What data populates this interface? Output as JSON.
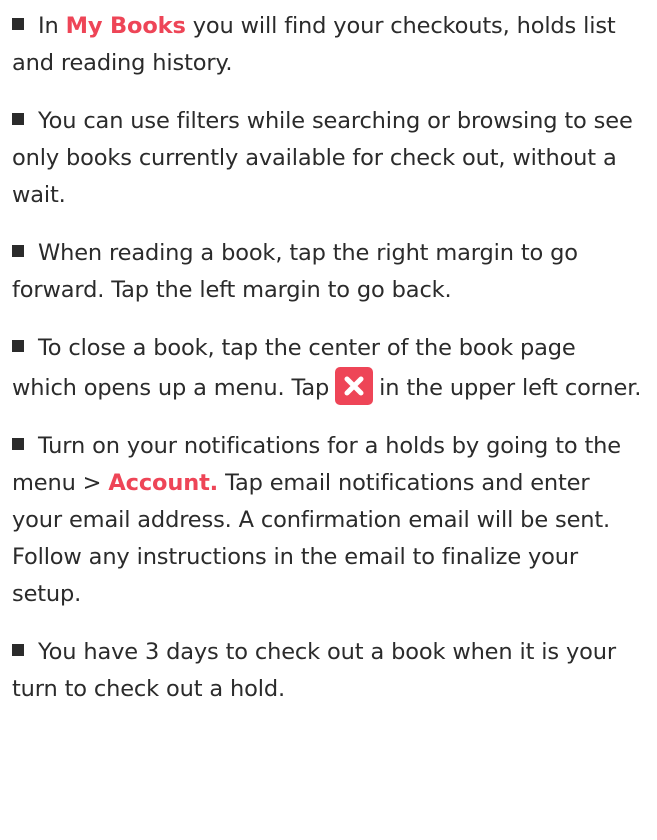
{
  "tips": [
    {
      "before": " In ",
      "highlight": "My Books",
      "after": " you will find your checkouts, holds list and reading history."
    },
    {
      "text": " You can use filters while searching or browsing to see only books currently available for check out, without a wait."
    },
    {
      "text": " When reading a book, tap the right margin to go forward. Tap the left margin to go back."
    },
    {
      "before": " To close a book, tap the center of the book page which opens up a menu. Tap",
      "icon": "close-x-icon",
      "after": "in the upper left corner."
    },
    {
      "before": " Turn on your notifications for a holds by going to the menu > ",
      "highlight": "Account.",
      "after": " Tap email notifications and enter your email address. A confirmation email will be sent. Follow any instructions in the email to finalize your setup."
    },
    {
      "text": " You have 3 days to check out a book when it is your turn to check out a hold."
    }
  ],
  "colors": {
    "accent": "#ee4557",
    "text": "#2b2b2b",
    "bullet": "#2b2b2b"
  }
}
